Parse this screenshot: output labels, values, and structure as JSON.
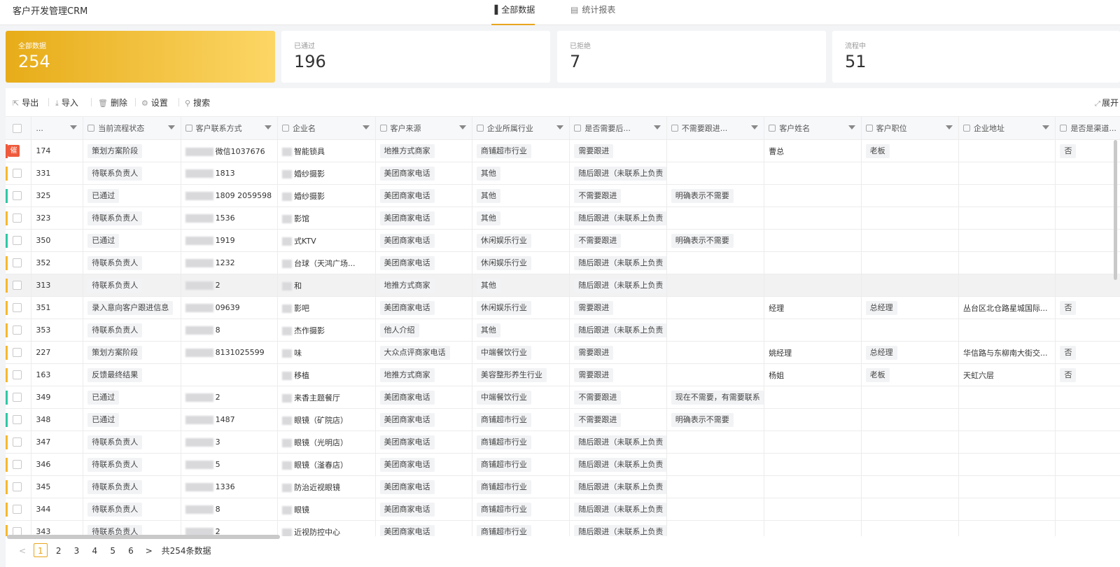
{
  "app": {
    "title": "客户开发管理CRM"
  },
  "nav": [
    {
      "label": "全部数据",
      "icon": "bar-chart-icon",
      "active": true
    },
    {
      "label": "统计报表",
      "icon": "report-icon",
      "active": false
    }
  ],
  "stats": [
    {
      "label": "全部数据",
      "value": "254"
    },
    {
      "label": "已通过",
      "value": "196"
    },
    {
      "label": "已拒绝",
      "value": "7"
    },
    {
      "label": "流程中",
      "value": "51"
    }
  ],
  "toolbar": {
    "export": "导出",
    "import": "导入",
    "delete": "删除",
    "settings": "设置",
    "search": "搜索",
    "expand": "展开"
  },
  "columns": [
    "...",
    "当前流程状态",
    "客户联系方式",
    "企业名",
    "客户来源",
    "企业所属行业",
    "是否需要后...",
    "不需要跟进...",
    "客户姓名",
    "客户职位",
    "企业地址",
    "是否是渠道..."
  ],
  "rows": [
    {
      "id": "174",
      "status": "策划方案阶段",
      "contact": "微信1037676",
      "company": "智能锁具",
      "source": "地推方式商家",
      "industry": "商铺超市行业",
      "follow": "需要跟进",
      "reason": "",
      "name": "曹总",
      "position": "老板",
      "address": "",
      "channel": "否",
      "bar": "#ef5a3c",
      "tag": "催"
    },
    {
      "id": "331",
      "status": "待联系负责人",
      "contact": "1813",
      "company": "婚纱摄影",
      "source": "美团商家电话",
      "industry": "其他",
      "follow": "随后跟进（未联系上负责",
      "reason": "",
      "name": "",
      "position": "",
      "address": "",
      "channel": "",
      "bar": "#f5b82e"
    },
    {
      "id": "325",
      "status": "已通过",
      "contact": "1809 2059598",
      "company": "婚纱摄影",
      "source": "美团商家电话",
      "industry": "其他",
      "follow": "不需要跟进",
      "reason": "明确表示不需要",
      "name": "",
      "position": "",
      "address": "",
      "channel": "",
      "bar": "#2ec7a4"
    },
    {
      "id": "323",
      "status": "待联系负责人",
      "contact": "1536",
      "company": "影馆",
      "source": "美团商家电话",
      "industry": "其他",
      "follow": "随后跟进（未联系上负责",
      "reason": "",
      "name": "",
      "position": "",
      "address": "",
      "channel": "",
      "bar": "#f5b82e"
    },
    {
      "id": "350",
      "status": "已通过",
      "contact": "1919",
      "company": "式KTV",
      "source": "美团商家电话",
      "industry": "休闲娱乐行业",
      "follow": "不需要跟进",
      "reason": "明确表示不需要",
      "name": "",
      "position": "",
      "address": "",
      "channel": "",
      "bar": "#2ec7a4"
    },
    {
      "id": "352",
      "status": "待联系负责人",
      "contact": "1232",
      "company": "台球（天鸿广场...",
      "source": "美团商家电话",
      "industry": "休闲娱乐行业",
      "follow": "随后跟进（未联系上负责",
      "reason": "",
      "name": "",
      "position": "",
      "address": "",
      "channel": "",
      "bar": "#f5b82e"
    },
    {
      "id": "313",
      "status": "待联系负责人",
      "contact": "2",
      "company": "和",
      "source": "地推方式商家",
      "industry": "其他",
      "follow": "随后跟进（未联系上负责",
      "reason": "",
      "name": "",
      "position": "",
      "address": "",
      "channel": "",
      "bar": "#f5b82e",
      "hl": true
    },
    {
      "id": "351",
      "status": "录入意向客户跟进信息",
      "contact": "09639",
      "company": "影吧",
      "source": "美团商家电话",
      "industry": "休闲娱乐行业",
      "follow": "需要跟进",
      "reason": "",
      "name": "经理",
      "position": "总经理",
      "address": "丛台区北仓路星城国际...",
      "channel": "否",
      "bar": "#f5b82e"
    },
    {
      "id": "353",
      "status": "待联系负责人",
      "contact": "8",
      "company": "杰作摄影",
      "source": "他人介绍",
      "industry": "其他",
      "follow": "随后跟进（未联系上负责",
      "reason": "",
      "name": "",
      "position": "",
      "address": "",
      "channel": "",
      "bar": "#f5b82e"
    },
    {
      "id": "227",
      "status": "策划方案阶段",
      "contact": "8131025599",
      "company": "味",
      "source": "大众点评商家电话",
      "industry": "中端餐饮行业",
      "follow": "需要跟进",
      "reason": "",
      "name": "姚经理",
      "position": "总经理",
      "address": "华信路与东柳南大街交...",
      "channel": "否",
      "bar": "#f5b82e"
    },
    {
      "id": "163",
      "status": "反馈最终结果",
      "contact": "",
      "company": "移植",
      "source": "地推方式商家",
      "industry": "美容整形养生行业",
      "follow": "需要跟进",
      "reason": "",
      "name": "杨姐",
      "position": "老板",
      "address": "天虹六层",
      "channel": "否",
      "bar": "#f5b82e"
    },
    {
      "id": "349",
      "status": "已通过",
      "contact": "2",
      "company": "来香主题餐厅",
      "source": "美团商家电话",
      "industry": "中端餐饮行业",
      "follow": "不需要跟进",
      "reason": "现在不需要，有需要联系",
      "name": "",
      "position": "",
      "address": "",
      "channel": "",
      "bar": "#2ec7a4"
    },
    {
      "id": "348",
      "status": "已通过",
      "contact": "1487",
      "company": "眼镜（矿院店）",
      "source": "美团商家电话",
      "industry": "商铺超市行业",
      "follow": "不需要跟进",
      "reason": "明确表示不需要",
      "name": "",
      "position": "",
      "address": "",
      "channel": "",
      "bar": "#2ec7a4"
    },
    {
      "id": "347",
      "status": "待联系负责人",
      "contact": "3",
      "company": "眼镜（光明店）",
      "source": "美团商家电话",
      "industry": "商铺超市行业",
      "follow": "随后跟进（未联系上负责",
      "reason": "",
      "name": "",
      "position": "",
      "address": "",
      "channel": "",
      "bar": "#f5b82e"
    },
    {
      "id": "346",
      "status": "待联系负责人",
      "contact": "5",
      "company": "眼镜（滏春店）",
      "source": "美团商家电话",
      "industry": "商铺超市行业",
      "follow": "随后跟进（未联系上负责",
      "reason": "",
      "name": "",
      "position": "",
      "address": "",
      "channel": "",
      "bar": "#f5b82e"
    },
    {
      "id": "345",
      "status": "待联系负责人",
      "contact": "1336",
      "company": "防治近视眼镜",
      "source": "美团商家电话",
      "industry": "商铺超市行业",
      "follow": "随后跟进（未联系上负责",
      "reason": "",
      "name": "",
      "position": "",
      "address": "",
      "channel": "",
      "bar": "#f5b82e"
    },
    {
      "id": "344",
      "status": "待联系负责人",
      "contact": "8",
      "company": "眼镜",
      "source": "美团商家电话",
      "industry": "商铺超市行业",
      "follow": "随后跟进（未联系上负责",
      "reason": "",
      "name": "",
      "position": "",
      "address": "",
      "channel": "",
      "bar": "#f5b82e"
    },
    {
      "id": "343",
      "status": "待联系负责人",
      "contact": "2",
      "company": "近视防控中心",
      "source": "美团商家电话",
      "industry": "商铺超市行业",
      "follow": "随后跟进（未联系上负责",
      "reason": "",
      "name": "",
      "position": "",
      "address": "",
      "channel": "",
      "bar": "#f5b82e"
    }
  ],
  "pagination": {
    "prev": "<",
    "pages": [
      "1",
      "2",
      "3",
      "4",
      "5",
      "6"
    ],
    "current": "1",
    "next": ">",
    "total": "共254条数据"
  }
}
